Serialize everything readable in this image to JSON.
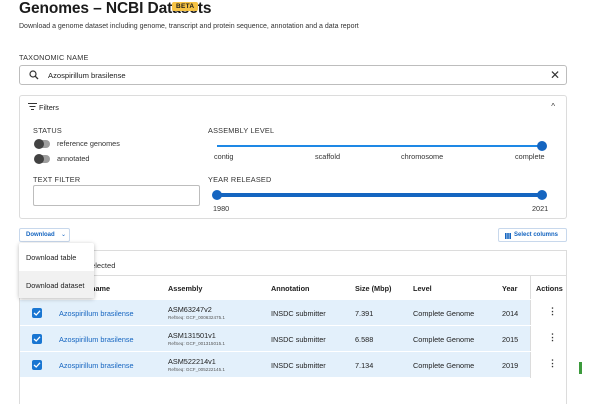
{
  "header": {
    "title": "Genomes – NCBI Datasets",
    "badge": "BETA",
    "subtitle": "Download a genome dataset including genome, transcript and protein sequence, annotation and a data report"
  },
  "taxonomy": {
    "label": "TAXONOMIC NAME",
    "value": "Azospirillum brasilense",
    "search_icon": "search-icon",
    "clear_icon": "close-icon"
  },
  "filters": {
    "label": "Filters",
    "status": {
      "label": "STATUS",
      "reference_label": "reference genomes",
      "reference_on": false,
      "annotated_label": "annotated",
      "annotated_on": false
    },
    "text_filter": {
      "label": "TEXT FILTER",
      "value": ""
    },
    "assembly_level": {
      "label": "ASSEMBLY LEVEL",
      "ticks": [
        "contig",
        "scaffold",
        "chromosome",
        "complete"
      ],
      "selected": "complete"
    },
    "year_released": {
      "label": "YEAR RELEASED",
      "min": "1980",
      "max": "2021"
    }
  },
  "toolbar": {
    "download_label": "Download",
    "select_columns_label": "Select columns"
  },
  "download_menu": {
    "items": [
      "Download table",
      "Download dataset"
    ]
  },
  "table": {
    "selected_text": "elected",
    "columns": [
      "name",
      "Assembly",
      "Annotation",
      "Size (Mbp)",
      "Level",
      "Year",
      "Actions"
    ],
    "rows": [
      {
        "organism": "Azospirillum brasilense",
        "assembly": "ASM63247v2",
        "accession": "RefSeq: GCF_000632475.1",
        "annotation": "INSDC submitter",
        "size": "7.391",
        "level": "Complete Genome",
        "year": "2014"
      },
      {
        "organism": "Azospirillum brasilense",
        "assembly": "ASM131501v1",
        "accession": "RefSeq: GCF_001315015.1",
        "annotation": "INSDC submitter",
        "size": "6.588",
        "level": "Complete Genome",
        "year": "2015"
      },
      {
        "organism": "Azospirillum brasilense",
        "assembly": "ASM522214v1",
        "accession": "RefSeq: GCF_005222145.1",
        "annotation": "INSDC submitter",
        "size": "7.134",
        "level": "Complete Genome",
        "year": "2019"
      }
    ]
  },
  "colors": {
    "accent": "#1565c0",
    "row_selected": "#e3f0fb",
    "badge": "#f6c344"
  }
}
